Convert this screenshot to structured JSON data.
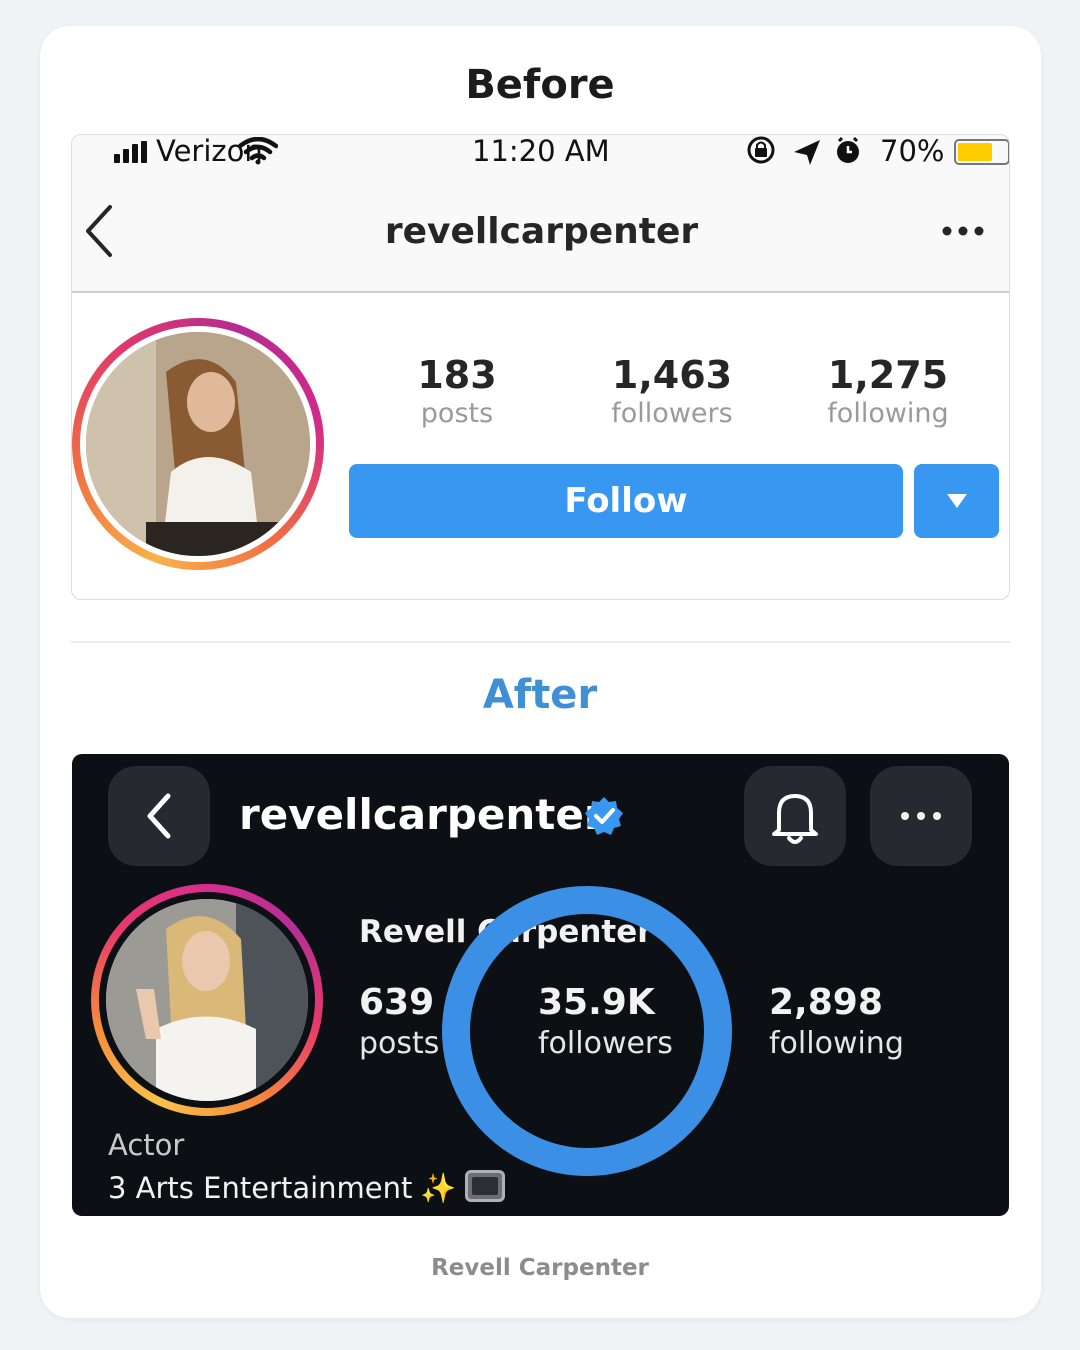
{
  "headings": {
    "before": "Before",
    "after": "After"
  },
  "before": {
    "status_bar": {
      "carrier": "Verizon",
      "time": "11:20 AM",
      "battery": "70%",
      "battery_level": 0.7
    },
    "nav": {
      "title": "revellcarpenter"
    },
    "stats": [
      {
        "value": "183",
        "label": "posts"
      },
      {
        "value": "1,463",
        "label": "followers"
      },
      {
        "value": "1,275",
        "label": "following"
      }
    ],
    "follow_label": "Follow",
    "colors": {
      "accent": "#3897f0"
    }
  },
  "after": {
    "username": "revellcarpenter",
    "display_name": "Revell Carpenter",
    "stats": [
      {
        "value": "639",
        "label": "posts"
      },
      {
        "value": "35.9K",
        "label": "followers"
      },
      {
        "value": "2,898",
        "label": "following"
      }
    ],
    "bio": {
      "line1": "Actor",
      "line2": "3 Arts Entertainment",
      "emoji": "✨"
    },
    "colors": {
      "background": "#0c0f14",
      "highlight": "#3b8fe5",
      "verified": "#3897f0"
    }
  },
  "caption": "Revell Carpenter"
}
